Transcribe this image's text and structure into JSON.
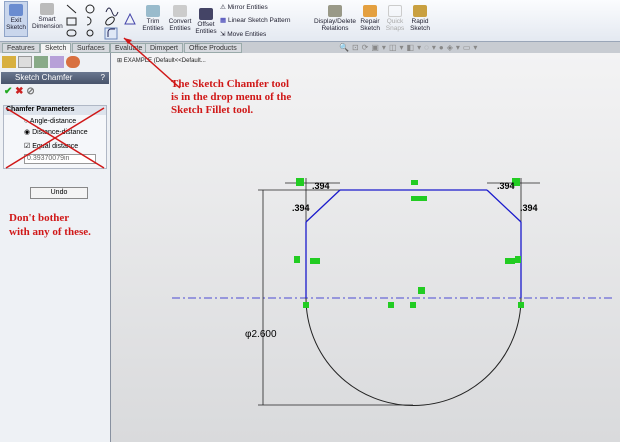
{
  "toolbar": {
    "exit_sketch": "Exit Sketch",
    "smart_dimension": "Smart Dimension",
    "trim": "Trim Entities",
    "convert": "Convert Entities",
    "offset": "Offset Entities",
    "mirror": "Mirror Entities",
    "linear_pattern": "Linear Sketch Pattern",
    "move": "Move Entities",
    "display_delete": "Display/Delete Relations",
    "repair": "Repair Sketch",
    "quick_snaps": "Quick Snaps",
    "rapid": "Rapid Sketch"
  },
  "tabs": [
    "Features",
    "Sketch",
    "Surfaces",
    "Evaluate",
    "Dimxpert",
    "Office Products"
  ],
  "panel": {
    "title": "Sketch Chamfer",
    "help": "?",
    "section": "Chamfer Parameters",
    "option1": "Angle-distance",
    "option2": "Distance-distance",
    "equal": "Equal distance",
    "distance_value": "0.39370079in",
    "undo": "Undo"
  },
  "tree": {
    "label": "EXAMPLE (Default<<Default..."
  },
  "annotations": {
    "top_line1": "The Sketch Chamfer tool",
    "top_line2": "is in the drop menu of the",
    "top_line3": "Sketch Fillet tool.",
    "panel_line1": "Don't bother",
    "panel_line2": "with any of these."
  },
  "dims": {
    "d1": ".394",
    "d2": ".394",
    "d3": ".394",
    "d4": ".394",
    "dia": "φ2.600"
  },
  "colors": {
    "annotation": "#d01818",
    "sketch": "#1a1acc"
  }
}
